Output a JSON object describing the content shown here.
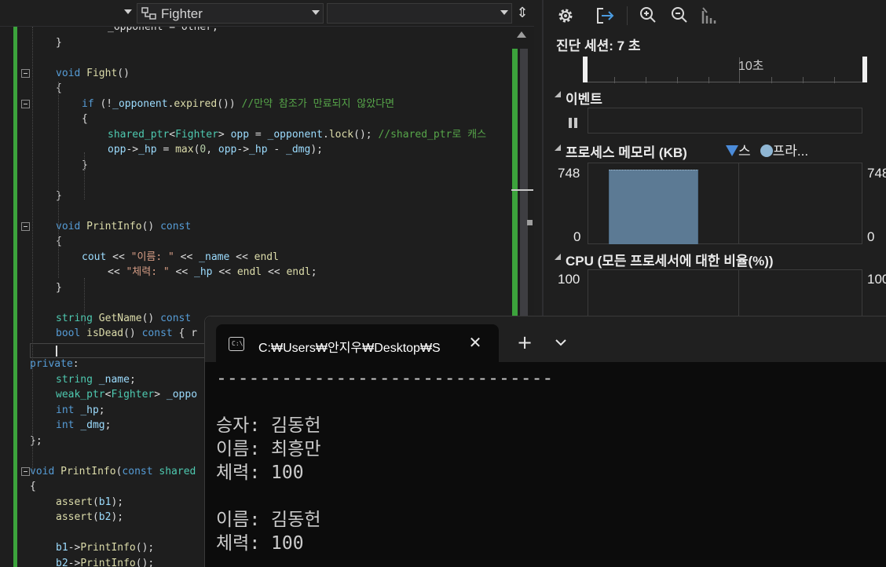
{
  "editor": {
    "nav": {
      "member_dropdown": "Fighter"
    },
    "code_lines": [
      [
        [
          "_opponent = other;",
          "pl"
        ]
      ],
      [
        [
          "}",
          "pl"
        ]
      ],
      [],
      [
        [
          "void ",
          "kw"
        ],
        [
          "Fight",
          "fn"
        ],
        [
          "()",
          "pl"
        ]
      ],
      [
        [
          "{",
          "pl"
        ]
      ],
      [
        [
          "if ",
          "kw"
        ],
        [
          "(!",
          "pl"
        ],
        [
          "_opponent",
          "vr"
        ],
        [
          ".",
          "pl"
        ],
        [
          "expired",
          "fn"
        ],
        [
          "()) ",
          "pl"
        ],
        [
          "//만약 참조가 만료되지 않았다면",
          "cm"
        ]
      ],
      [
        [
          "{",
          "pl"
        ]
      ],
      [
        [
          "shared_ptr",
          "ty"
        ],
        [
          "<",
          "pl"
        ],
        [
          "Fighter",
          "ty"
        ],
        [
          "> ",
          "pl"
        ],
        [
          "opp",
          "vr"
        ],
        [
          " = ",
          "pl"
        ],
        [
          "_opponent",
          "vr"
        ],
        [
          ".",
          "pl"
        ],
        [
          "lock",
          "fn"
        ],
        [
          "(); ",
          "pl"
        ],
        [
          "//shared_ptr로 캐스",
          "cm"
        ]
      ],
      [
        [
          "opp",
          "vr"
        ],
        [
          "->",
          "pl"
        ],
        [
          "_hp",
          "vr"
        ],
        [
          " = ",
          "pl"
        ],
        [
          "max",
          "fn"
        ],
        [
          "(",
          "pl"
        ],
        [
          "0",
          "nm"
        ],
        [
          ", ",
          "pl"
        ],
        [
          "opp",
          "vr"
        ],
        [
          "->",
          "pl"
        ],
        [
          "_hp",
          "vr"
        ],
        [
          " - ",
          "pl"
        ],
        [
          "_dmg",
          "vr"
        ],
        [
          ");",
          "pl"
        ]
      ],
      [
        [
          "}",
          "pl"
        ]
      ],
      [],
      [
        [
          "}",
          "pl"
        ]
      ],
      [],
      [
        [
          "void ",
          "kw"
        ],
        [
          "PrintInfo",
          "fn"
        ],
        [
          "() ",
          "pl"
        ],
        [
          "const",
          "kw"
        ]
      ],
      [
        [
          "{",
          "pl"
        ]
      ],
      [
        [
          "cout",
          "vr"
        ],
        [
          " << ",
          "pl"
        ],
        [
          "\"이름: \"",
          "st"
        ],
        [
          " << ",
          "pl"
        ],
        [
          "_name",
          "vr"
        ],
        [
          " << ",
          "pl"
        ],
        [
          "endl",
          "fn"
        ]
      ],
      [
        [
          "<< ",
          "pl"
        ],
        [
          "\"체력: \"",
          "st"
        ],
        [
          " << ",
          "pl"
        ],
        [
          "_hp",
          "vr"
        ],
        [
          " << ",
          "pl"
        ],
        [
          "endl",
          "fn"
        ],
        [
          " << ",
          "pl"
        ],
        [
          "endl",
          "fn"
        ],
        [
          ";",
          "pl"
        ]
      ],
      [
        [
          "}",
          "pl"
        ]
      ],
      [],
      [
        [
          "string ",
          "ty"
        ],
        [
          "GetName",
          "fn"
        ],
        [
          "() ",
          "pl"
        ],
        [
          "const",
          "kw"
        ]
      ],
      [
        [
          "bool ",
          "kw"
        ],
        [
          "isDead",
          "fn"
        ],
        [
          "() ",
          "pl"
        ],
        [
          "const",
          "kw"
        ],
        [
          " { r",
          "pl"
        ]
      ],
      [],
      [
        [
          "private",
          "kw"
        ],
        [
          ":",
          "pl"
        ]
      ],
      [
        [
          "string ",
          "ty"
        ],
        [
          "_name",
          "vr"
        ],
        [
          ";",
          "pl"
        ]
      ],
      [
        [
          "weak_ptr",
          "ty"
        ],
        [
          "<",
          "pl"
        ],
        [
          "Fighter",
          "ty"
        ],
        [
          "> ",
          "pl"
        ],
        [
          "_oppo",
          "vr"
        ]
      ],
      [
        [
          "int ",
          "kw"
        ],
        [
          "_hp",
          "vr"
        ],
        [
          ";",
          "pl"
        ]
      ],
      [
        [
          "int ",
          "kw"
        ],
        [
          "_dmg",
          "vr"
        ],
        [
          ";",
          "pl"
        ]
      ],
      [
        [
          "};",
          "pl"
        ]
      ],
      [],
      [
        [
          "void ",
          "kw"
        ],
        [
          "PrintInfo",
          "fn"
        ],
        [
          "(",
          "pl"
        ],
        [
          "const ",
          "kw"
        ],
        [
          "shared",
          "ty"
        ]
      ],
      [
        [
          "{",
          "pl"
        ]
      ],
      [
        [
          "assert",
          "fn"
        ],
        [
          "(",
          "pl"
        ],
        [
          "b1",
          "vr"
        ],
        [
          ");",
          "pl"
        ]
      ],
      [
        [
          "assert",
          "fn"
        ],
        [
          "(",
          "pl"
        ],
        [
          "b2",
          "vr"
        ],
        [
          ");",
          "pl"
        ]
      ],
      [],
      [
        [
          "b1",
          "vr"
        ],
        [
          "->",
          "pl"
        ],
        [
          "PrintInfo",
          "fn"
        ],
        [
          "();",
          "pl"
        ]
      ],
      [
        [
          "b2",
          "vr"
        ],
        [
          "->",
          "pl"
        ],
        [
          "PrintInfo",
          "fn"
        ],
        [
          "();",
          "pl"
        ]
      ]
    ]
  },
  "diagnostics": {
    "session_label": "진단 세션: 7 초",
    "timeline_label": "10초",
    "events_header": "이벤트",
    "memory_header": "프로세스 메모리 (KB)",
    "memory_legend": [
      "스",
      "프라..."
    ],
    "memory_y_max": "748",
    "memory_y_min": "0",
    "memory_value_kb": 748,
    "cpu_header": "CPU (모든 프로세서에 대한 비율(%))",
    "cpu_y_max": "100",
    "colors": {
      "legend_triangle": "#4b8bd9",
      "legend_dot": "#8fb6d3",
      "memory_fill": "#5c7a94"
    }
  },
  "terminal": {
    "tab_title": "C:₩Users₩안지우₩Desktop₩S",
    "tab_icon_text": "C:\\",
    "lines": [
      "-------------------------------",
      "",
      "승자: 김동헌",
      "이름: 최흥만",
      "체력: 100",
      "",
      "이름: 김동헌",
      "체력: 100"
    ]
  }
}
